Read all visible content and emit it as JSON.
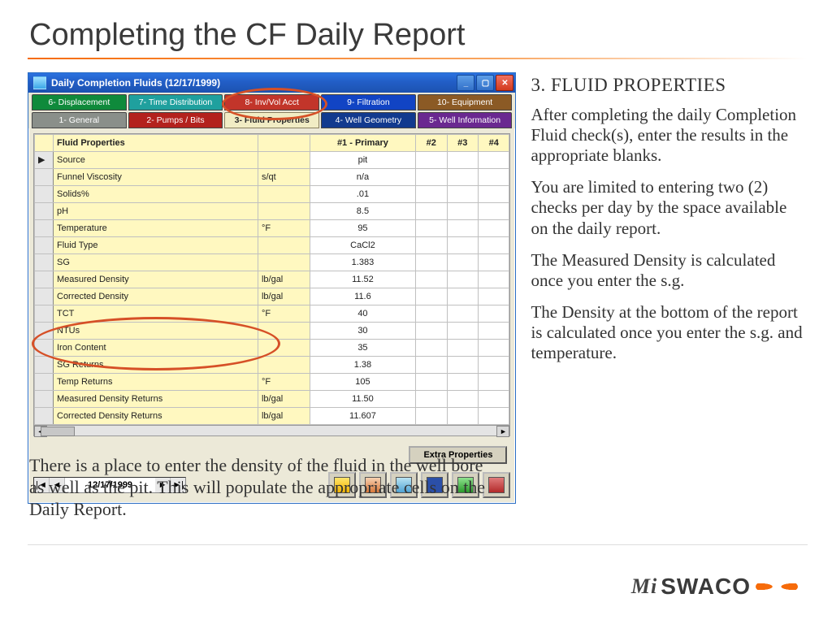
{
  "slide_title": "Completing the CF Daily Report",
  "window": {
    "title": "Daily Completion Fluids (12/17/1999)",
    "tabs_top": [
      {
        "label": "6- Displacement",
        "cls": "green"
      },
      {
        "label": "7- Time Distribution",
        "cls": "cyan"
      },
      {
        "label": "8- Inv/Vol Acct",
        "cls": "red"
      },
      {
        "label": "9- Filtration",
        "cls": "blue"
      },
      {
        "label": "10- Equipment",
        "cls": "brown"
      }
    ],
    "tabs_bottom": [
      {
        "label": "1- General",
        "cls": "gray"
      },
      {
        "label": "2- Pumps / Bits",
        "cls": "red2"
      },
      {
        "label": "3- Fluid Properties",
        "cls": "cream"
      },
      {
        "label": "4- Well Geometry",
        "cls": "dblue"
      },
      {
        "label": "5- Well Information",
        "cls": "purple"
      }
    ],
    "grid": {
      "header": {
        "c0": "Fluid Properties",
        "c1": "",
        "c2": "#1 - Primary",
        "c3": "#2",
        "c4": "#3",
        "c5": "#4"
      },
      "rows": [
        {
          "label": "Source",
          "unit": "",
          "v1": "pit"
        },
        {
          "label": "Funnel Viscosity",
          "unit": "s/qt",
          "v1": "n/a"
        },
        {
          "label": "Solids%",
          "unit": "",
          "v1": ".01"
        },
        {
          "label": "pH",
          "unit": "",
          "v1": "8.5"
        },
        {
          "label": "Temperature",
          "unit": "°F",
          "v1": "95"
        },
        {
          "label": "Fluid Type",
          "unit": "",
          "v1": "CaCl2"
        },
        {
          "label": "SG",
          "unit": "",
          "v1": "1.383"
        },
        {
          "label": "Measured Density",
          "unit": "lb/gal",
          "v1": "11.52"
        },
        {
          "label": "Corrected Density",
          "unit": "lb/gal",
          "v1": "11.6"
        },
        {
          "label": "TCT",
          "unit": "°F",
          "v1": "40"
        },
        {
          "label": "NTUs",
          "unit": "",
          "v1": "30"
        },
        {
          "label": "Iron Content",
          "unit": "",
          "v1": "35"
        },
        {
          "label": "SG Returns",
          "unit": "",
          "v1": "1.38"
        },
        {
          "label": "Temp Returns",
          "unit": "°F",
          "v1": "105"
        },
        {
          "label": "Measured Density Returns",
          "unit": "lb/gal",
          "v1": "11.50"
        },
        {
          "label": "Corrected Density Returns",
          "unit": "lb/gal",
          "v1": "11.607"
        }
      ]
    },
    "extra_button": "Extra Properties",
    "nav_date": "12/17/1999"
  },
  "side": {
    "heading": "3. FLUID PROPERTIES",
    "p1": "After completing the daily Completion Fluid check(s), enter the results in the appropriate blanks.",
    "p2": "You are limited to entering two (2) checks per day by the space available on the daily report.",
    "p3": "The  Measured Density  is calculated once you enter the s.g.",
    "p4": "The Density at the bottom of the report is calculated once you enter the s.g. and temperature."
  },
  "below": "There is a place to enter the density of the fluid in the well bore as well as the pit.  This will populate the appropriate cells on the Daily Report.",
  "logo": {
    "mi": "Mi",
    "sw": "SWACO"
  }
}
